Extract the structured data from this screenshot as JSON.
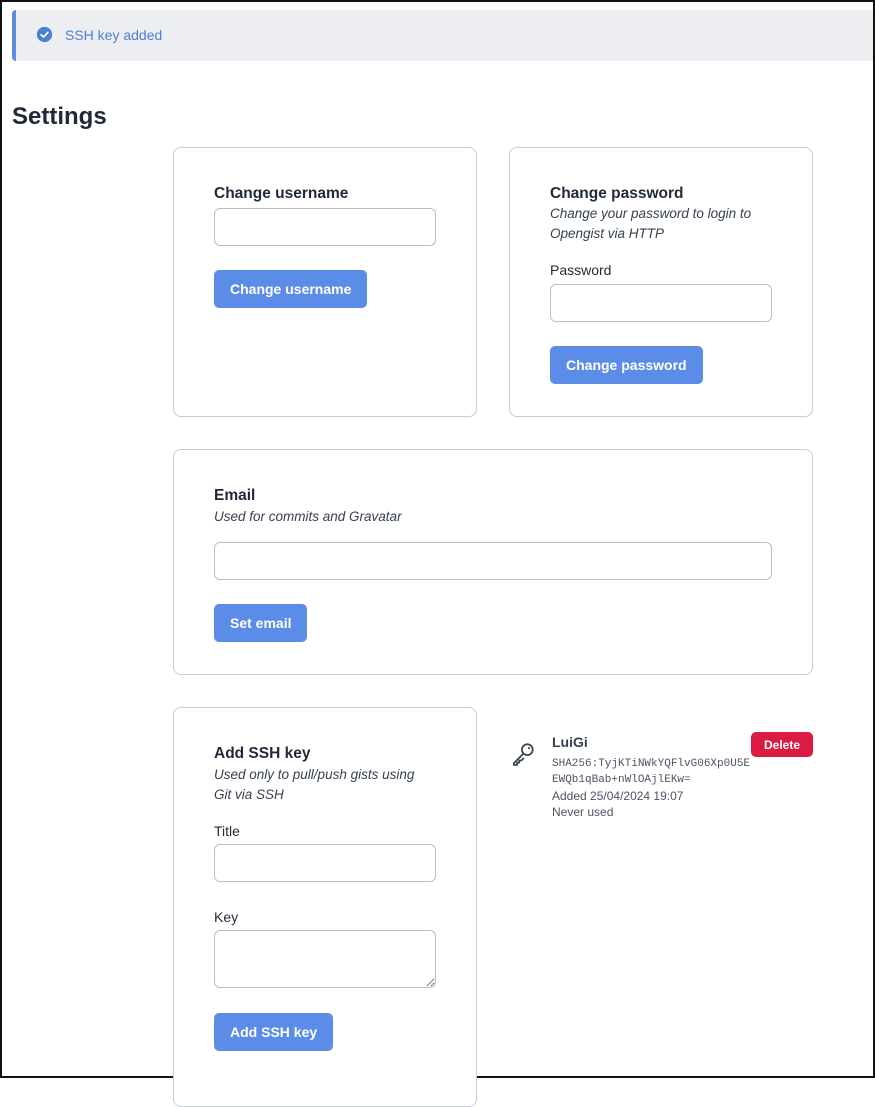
{
  "flash": {
    "icon": "check-circle-icon",
    "message": "SSH key added",
    "accent": "#5b8ce0"
  },
  "page": {
    "title": "Settings"
  },
  "username_card": {
    "heading": "Change username",
    "input_value": "",
    "button_label": "Change username"
  },
  "password_card": {
    "heading": "Change password",
    "description": "Change your password to login to Opengist via HTTP",
    "field_label": "Password",
    "input_value": "",
    "button_label": "Change password"
  },
  "email_card": {
    "heading": "Email",
    "description": "Used for commits and Gravatar",
    "input_value": "",
    "button_label": "Set email"
  },
  "ssh_card": {
    "heading": "Add SSH key",
    "description": "Used only to pull/push gists using Git via SSH",
    "title_label": "Title",
    "title_value": "",
    "key_label": "Key",
    "key_value": "",
    "button_label": "Add SSH key"
  },
  "ssh_keys": [
    {
      "icon": "key-icon",
      "title": "LuiGi",
      "fingerprint": "SHA256:TyjKTiNWkYQFlvG06Xp0U5EEWQb1qBab+nWlOAjlEKw=",
      "added": "Added 25/04/2024 19:07",
      "last_used": "Never used",
      "delete_label": "Delete"
    }
  ],
  "colors": {
    "primary_button": "#5b8de8",
    "danger_button": "#dc1b45",
    "card_border": "#c9cdd3"
  }
}
